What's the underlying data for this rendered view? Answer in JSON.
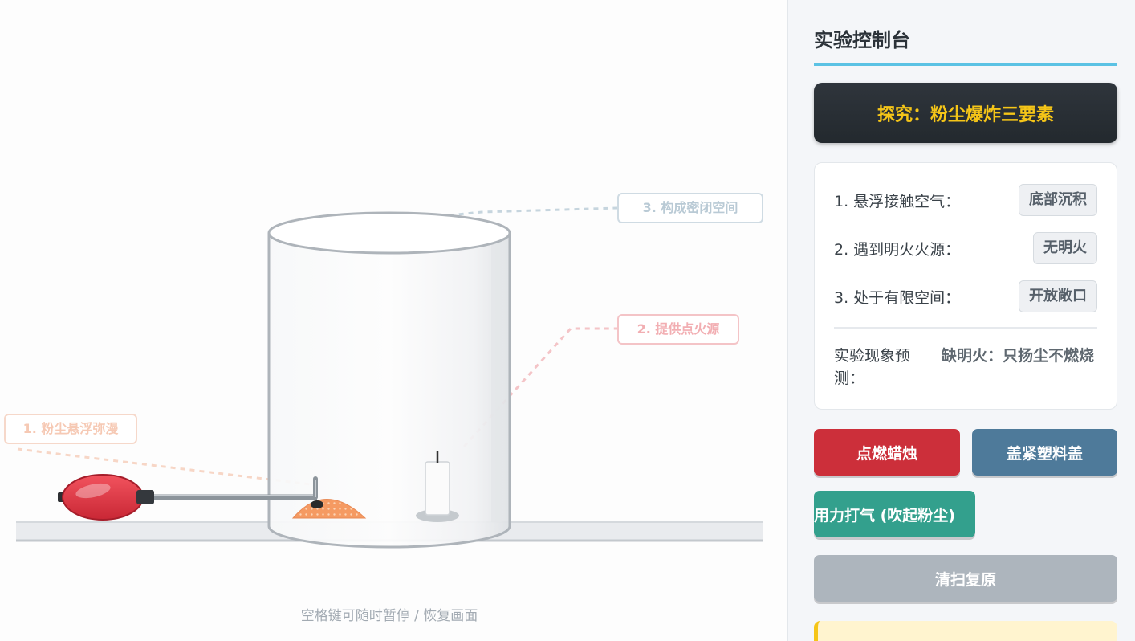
{
  "stage": {
    "callouts": {
      "suspend": "1. 粉尘悬浮弥漫",
      "ignition": "2. 提供点火源",
      "enclosure": "3. 构成密闭空间"
    },
    "hint": "空格键可随时暂停 / 恢复画面"
  },
  "panel": {
    "title": "实验控制台",
    "topic": "探究：粉尘爆炸三要素",
    "factors": [
      {
        "label": "1. 悬浮接触空气：",
        "state": "底部沉积"
      },
      {
        "label": "2. 遇到明火火源：",
        "state": "无明火"
      },
      {
        "label": "3. 处于有限空间：",
        "state": "开放敞口"
      }
    ],
    "prediction": {
      "label": "实验现象预测：",
      "value": "缺明火：只扬尘不燃烧"
    },
    "buttons": {
      "ignite": "点燃蜡烛",
      "cover": "盖紧塑料盖",
      "pump": "用力打气 (吹起粉尘)",
      "reset": "清扫复原"
    }
  },
  "colors": {
    "accent": "#5bc2e4",
    "topic_text": "#f5c518",
    "ignite": "#cc2f3a",
    "cover": "#4e7a9a",
    "pump": "#33a08d",
    "reset": "#adb5bd"
  }
}
